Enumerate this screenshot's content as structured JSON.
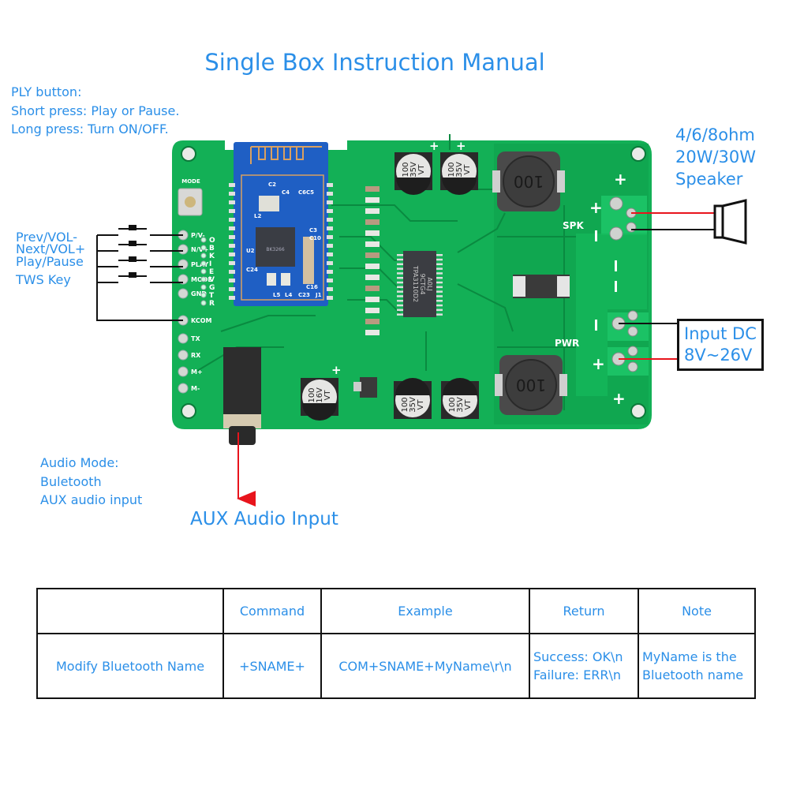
{
  "title": "Single Box Instruction Manual",
  "ply_note": {
    "lines": [
      "PLY button:",
      "Short press: Play or Pause.",
      "Long press: Turn ON/OFF."
    ]
  },
  "key_labels": [
    "Prev/VOL-",
    "Next/VOL+",
    "Play/Pause",
    "TWS Key"
  ],
  "speaker_spec": {
    "lines": [
      "4/6/8ohm",
      "20W/30W",
      "Speaker"
    ]
  },
  "input_dc": {
    "lines": [
      "Input DC",
      "8V~26V"
    ]
  },
  "audio_mode": {
    "lines": [
      "Audio Mode:",
      "Buletooth",
      "AUX audio input"
    ]
  },
  "aux_label": "AUX Audio Input",
  "board": {
    "left_pins": [
      "P/V-",
      "N/V+",
      "PLAY",
      "MODE",
      "GND",
      "KCOM",
      "TX",
      "RX",
      "M+",
      "M-"
    ],
    "mode_button_label": "MODE",
    "side_letters": [
      "O",
      "B",
      "K",
      "I",
      "E",
      "V",
      "G",
      "T",
      "R"
    ],
    "speaker_label": "SPK",
    "power_label": "PWR",
    "amp_chip": [
      "TPA3110D2",
      "9CTG4",
      "A0LJ"
    ],
    "cap_large": [
      "100",
      "35V",
      "VT"
    ],
    "cap_small": [
      "100",
      "16V",
      "VT"
    ],
    "inductor_value": "100",
    "bt_module_labels": [
      "C2",
      "C4",
      "C6C5",
      "C3",
      "C10",
      "C24",
      "L5",
      "L4",
      "C23",
      "J1",
      "C16",
      "L2",
      "U2"
    ],
    "plus": "+",
    "minus": "−"
  },
  "colors": {
    "text_blue": "#2b8fe8",
    "pcb_green": "#13b056",
    "trace_green": "#0a8a40",
    "bt_blue": "#1f5fc4",
    "wire_red": "#e8141c",
    "wire_black": "#111111"
  },
  "command_table": {
    "headers": [
      "",
      "Command",
      "Example",
      "Return",
      "Note"
    ],
    "rows": [
      {
        "function": "Modify Bluetooth Name",
        "command": "+SNAME+",
        "example": "COM+SNAME+MyName\\r\\n",
        "return_lines": [
          "Success: OK\\n",
          "Failure: ERR\\n"
        ],
        "note_lines": [
          "MyName is the",
          "Bluetooth name"
        ]
      }
    ]
  }
}
